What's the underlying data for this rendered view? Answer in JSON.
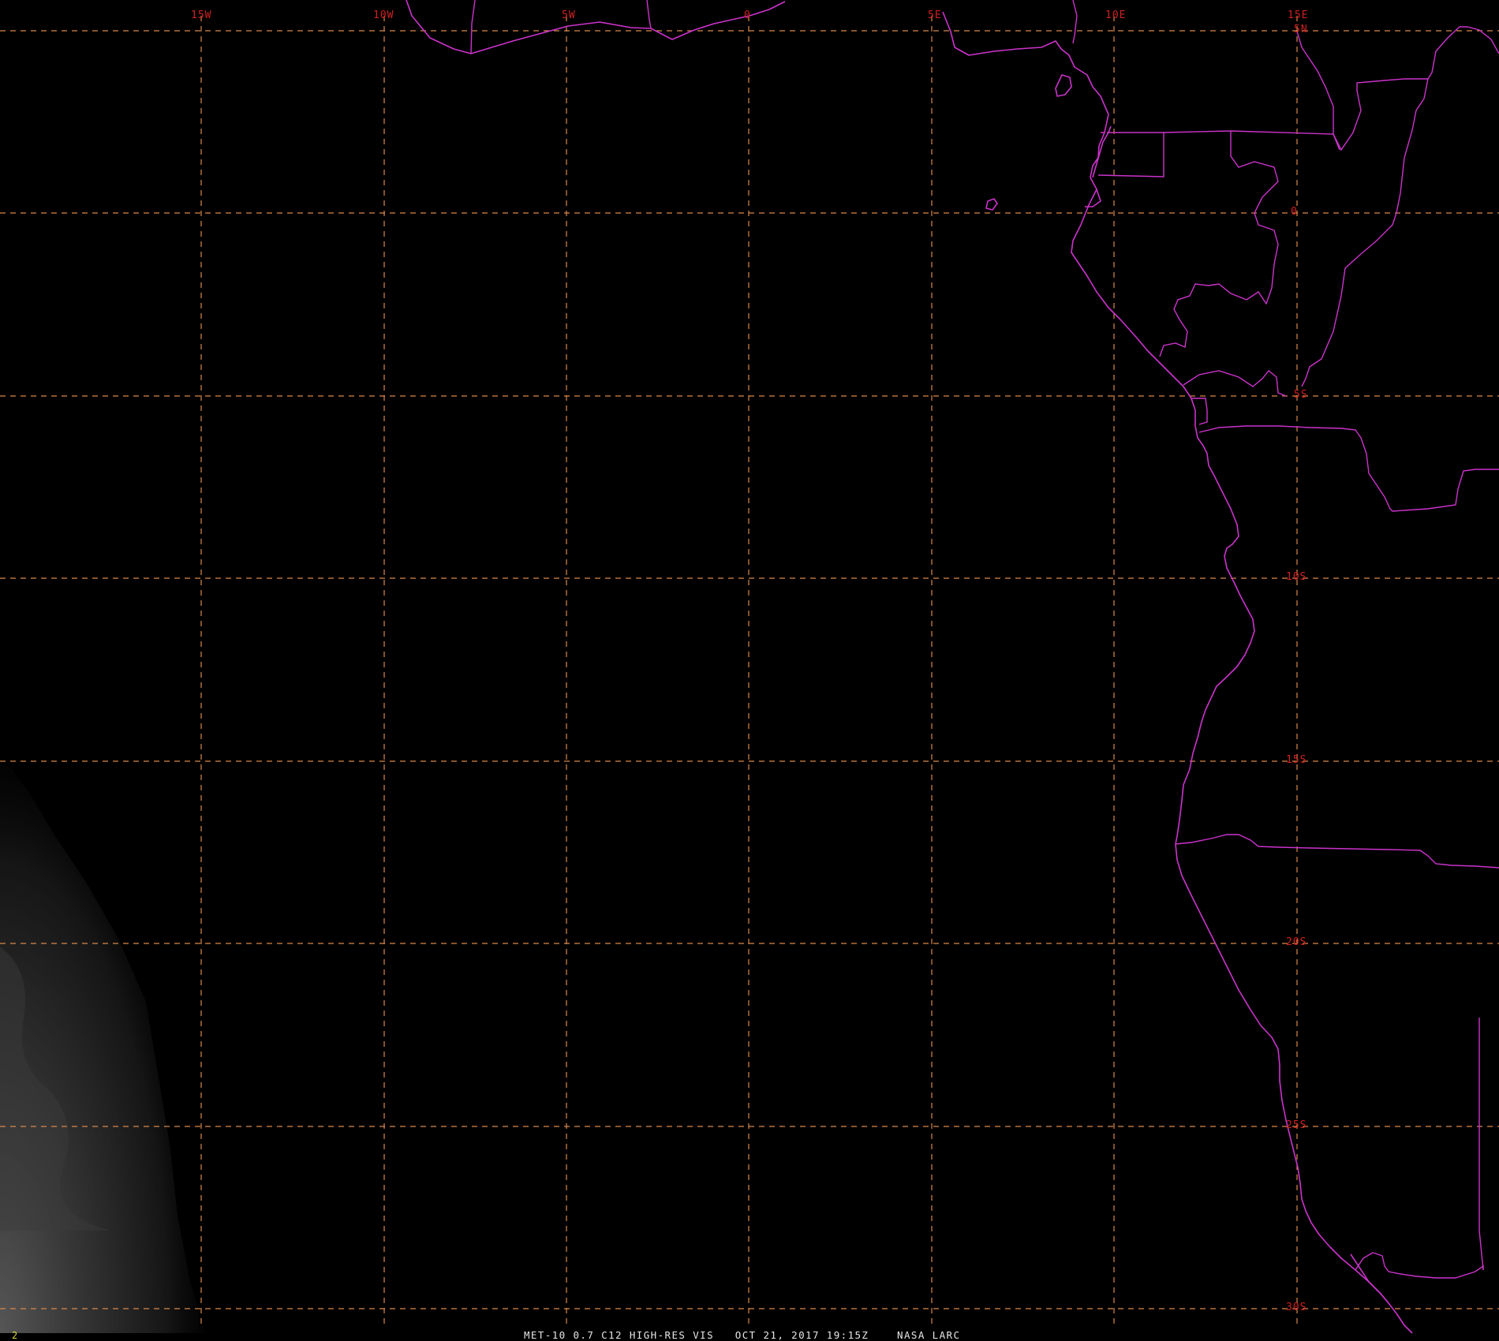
{
  "map": {
    "background": "#000000",
    "grid_color": "#d9884a",
    "label_color": "#d02020",
    "border_color": "#cc33cc",
    "longitude_labels": [
      "15W",
      "10W",
      "5W",
      "0",
      "5E",
      "10E",
      "15E"
    ],
    "latitude_labels": [
      "5N",
      "0",
      "5S",
      "10S",
      "15S",
      "20S",
      "25S",
      "30S"
    ],
    "footer": "MET-10 0.7 C12 HIGH-RES VIS   OCT 21, 2017 19:15Z    NASA LARC",
    "frame_number": "2"
  }
}
